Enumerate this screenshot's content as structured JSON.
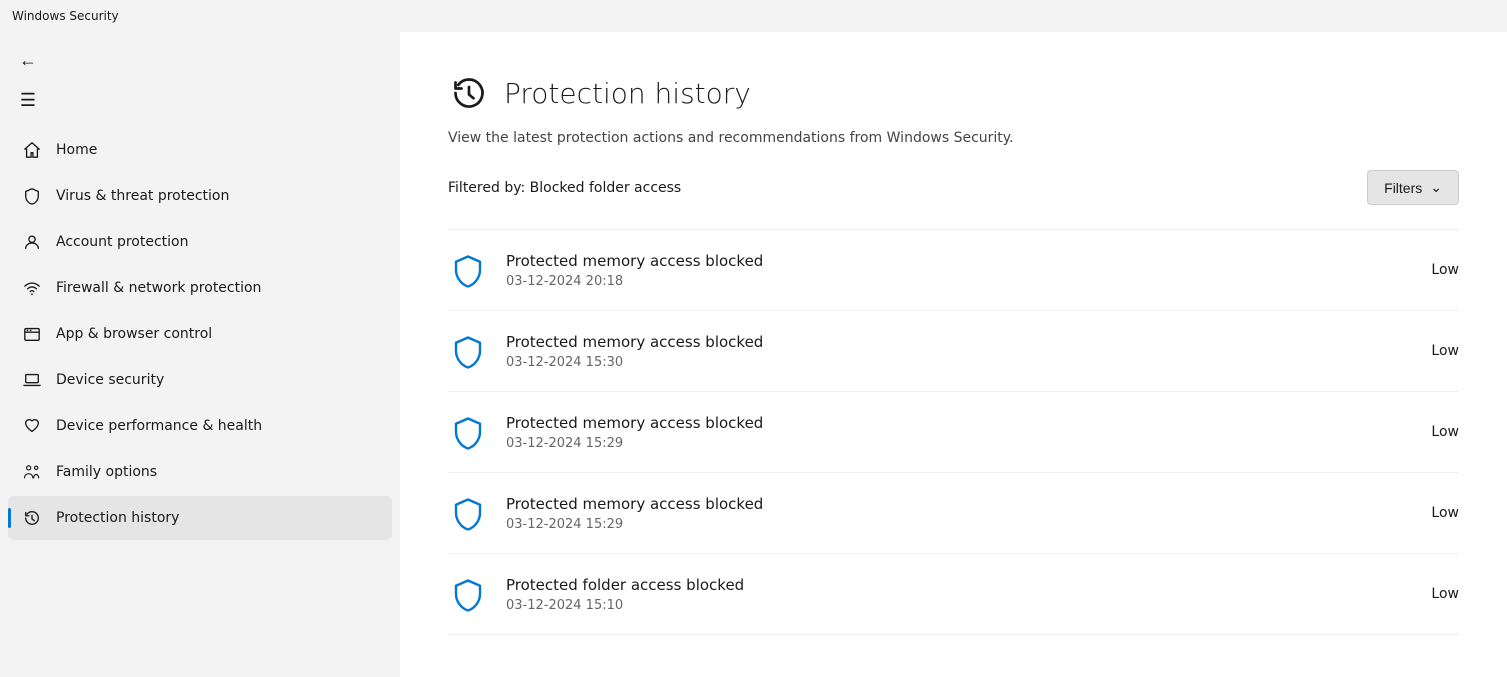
{
  "titleBar": {
    "appName": "Windows Security"
  },
  "sidebar": {
    "backArrow": "←",
    "hamburger": "☰",
    "navItems": [
      {
        "id": "home",
        "label": "Home",
        "icon": "home",
        "active": false
      },
      {
        "id": "virus",
        "label": "Virus & threat protection",
        "icon": "shield",
        "active": false
      },
      {
        "id": "account",
        "label": "Account protection",
        "icon": "account",
        "active": false
      },
      {
        "id": "firewall",
        "label": "Firewall & network protection",
        "icon": "wifi",
        "active": false
      },
      {
        "id": "app-browser",
        "label": "App & browser control",
        "icon": "app",
        "active": false
      },
      {
        "id": "device-security",
        "label": "Device security",
        "icon": "laptop",
        "active": false
      },
      {
        "id": "device-health",
        "label": "Device performance & health",
        "icon": "heart",
        "active": false
      },
      {
        "id": "family",
        "label": "Family options",
        "icon": "family",
        "active": false
      },
      {
        "id": "protection-history",
        "label": "Protection history",
        "icon": "history",
        "active": true
      }
    ]
  },
  "content": {
    "pageTitle": "Protection history",
    "pageSubtitle": "View the latest protection actions and recommendations from Windows Security.",
    "filterLabel": "Filtered by: Blocked folder access",
    "filterBtnLabel": "Filters",
    "historyItems": [
      {
        "id": 1,
        "title": "Protected memory access blocked",
        "time": "03-12-2024 20:18",
        "severity": "Low"
      },
      {
        "id": 2,
        "title": "Protected memory access blocked",
        "time": "03-12-2024 15:30",
        "severity": "Low"
      },
      {
        "id": 3,
        "title": "Protected memory access blocked",
        "time": "03-12-2024 15:29",
        "severity": "Low"
      },
      {
        "id": 4,
        "title": "Protected memory access blocked",
        "time": "03-12-2024 15:29",
        "severity": "Low"
      },
      {
        "id": 5,
        "title": "Protected folder access blocked",
        "time": "03-12-2024 15:10",
        "severity": "Low"
      }
    ]
  }
}
